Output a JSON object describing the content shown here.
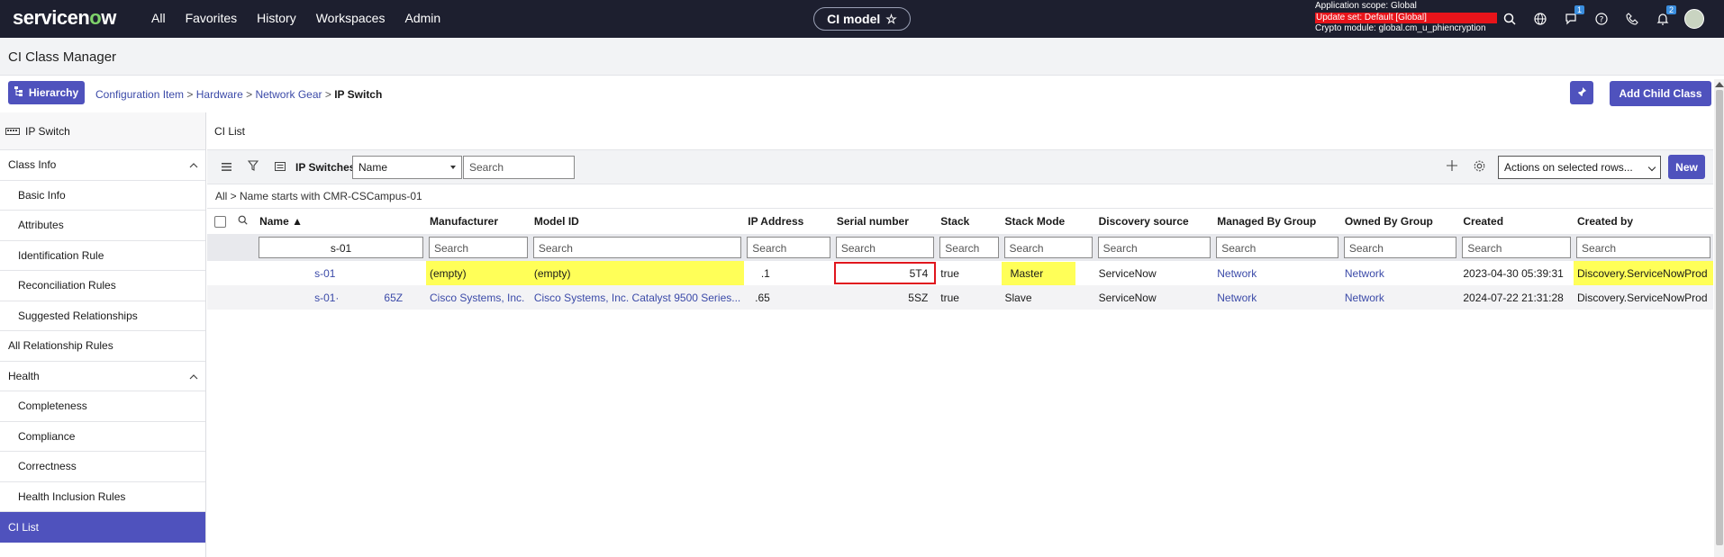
{
  "topbar": {
    "logo": {
      "pre": "servicen",
      "o": "o",
      "post": "w"
    },
    "nav": [
      "All",
      "Favorites",
      "History",
      "Workspaces",
      "Admin"
    ],
    "workspace_pill": "CI model",
    "scope_line": "Application scope: Global",
    "update_set": "Update set: Default [Global]",
    "crypto": "Crypto module: global.cm_u_phiencryption",
    "chat_badge": "1",
    "notif_badge": "2"
  },
  "page_title": "CI Class Manager",
  "hierarchy_button": "Hierarchy",
  "breadcrumb": {
    "items": [
      "Configuration Item",
      "Hardware",
      "Network Gear"
    ],
    "current": "IP Switch"
  },
  "add_child_button": "Add Child Class",
  "sidebar": {
    "class_name": "IP Switch",
    "sections": [
      {
        "label": "Class Info",
        "top": true
      },
      {
        "label": "Basic Info"
      },
      {
        "label": "Attributes"
      },
      {
        "label": "Identification Rule"
      },
      {
        "label": "Reconciliation Rules"
      },
      {
        "label": "Suggested Relationships"
      },
      {
        "label": "All Relationship Rules",
        "top": true
      },
      {
        "label": "Health",
        "top": true
      },
      {
        "label": "Completeness"
      },
      {
        "label": "Compliance"
      },
      {
        "label": "Correctness"
      },
      {
        "label": "Health Inclusion Rules"
      },
      {
        "label": "CI List",
        "active": true
      }
    ]
  },
  "cilist": {
    "title": "CI List",
    "table_label": "IP Switches",
    "search_field": "Name",
    "search_placeholder": "Search",
    "actions": "Actions on selected rows...",
    "new_button": "New",
    "filter": "All > Name starts with CMR-CSCampus-01",
    "columns": [
      "Name ▲",
      "Manufacturer",
      "Model ID",
      "IP Address",
      "Serial number",
      "Stack",
      "Stack Mode",
      "Discovery source",
      "Managed By Group",
      "Owned By Group",
      "Created",
      "Created by"
    ],
    "name_filter_value": "s-01",
    "rows": [
      {
        "name": "s-01",
        "name_suffix": "",
        "manufacturer": "(empty)",
        "model": "(empty)",
        "ip": ".1",
        "serial": "5T4",
        "stack": "true",
        "stack_mode": "Master",
        "discovery": "ServiceNow",
        "managed": "Network",
        "owned": "Network",
        "created": "2023-04-30 05:39:31",
        "created_by": "Discovery.ServiceNowProd"
      },
      {
        "name": "s-01·",
        "name_suffix": "65Z",
        "manufacturer": "Cisco Systems, Inc.",
        "model": "Cisco Systems, Inc. Catalyst 9500 Series...",
        "ip": ".65",
        "serial": "5SZ",
        "stack": "true",
        "stack_mode": "Slave",
        "discovery": "ServiceNow",
        "managed": "Network",
        "owned": "Network",
        "created": "2024-07-22 21:31:28",
        "created_by": "Discovery.ServiceNowProd"
      }
    ]
  },
  "colors": {
    "topbar": "#1d1f2f",
    "accent": "#4f52bd",
    "highlight": "#ffff58",
    "update_set": "#e8141a"
  }
}
